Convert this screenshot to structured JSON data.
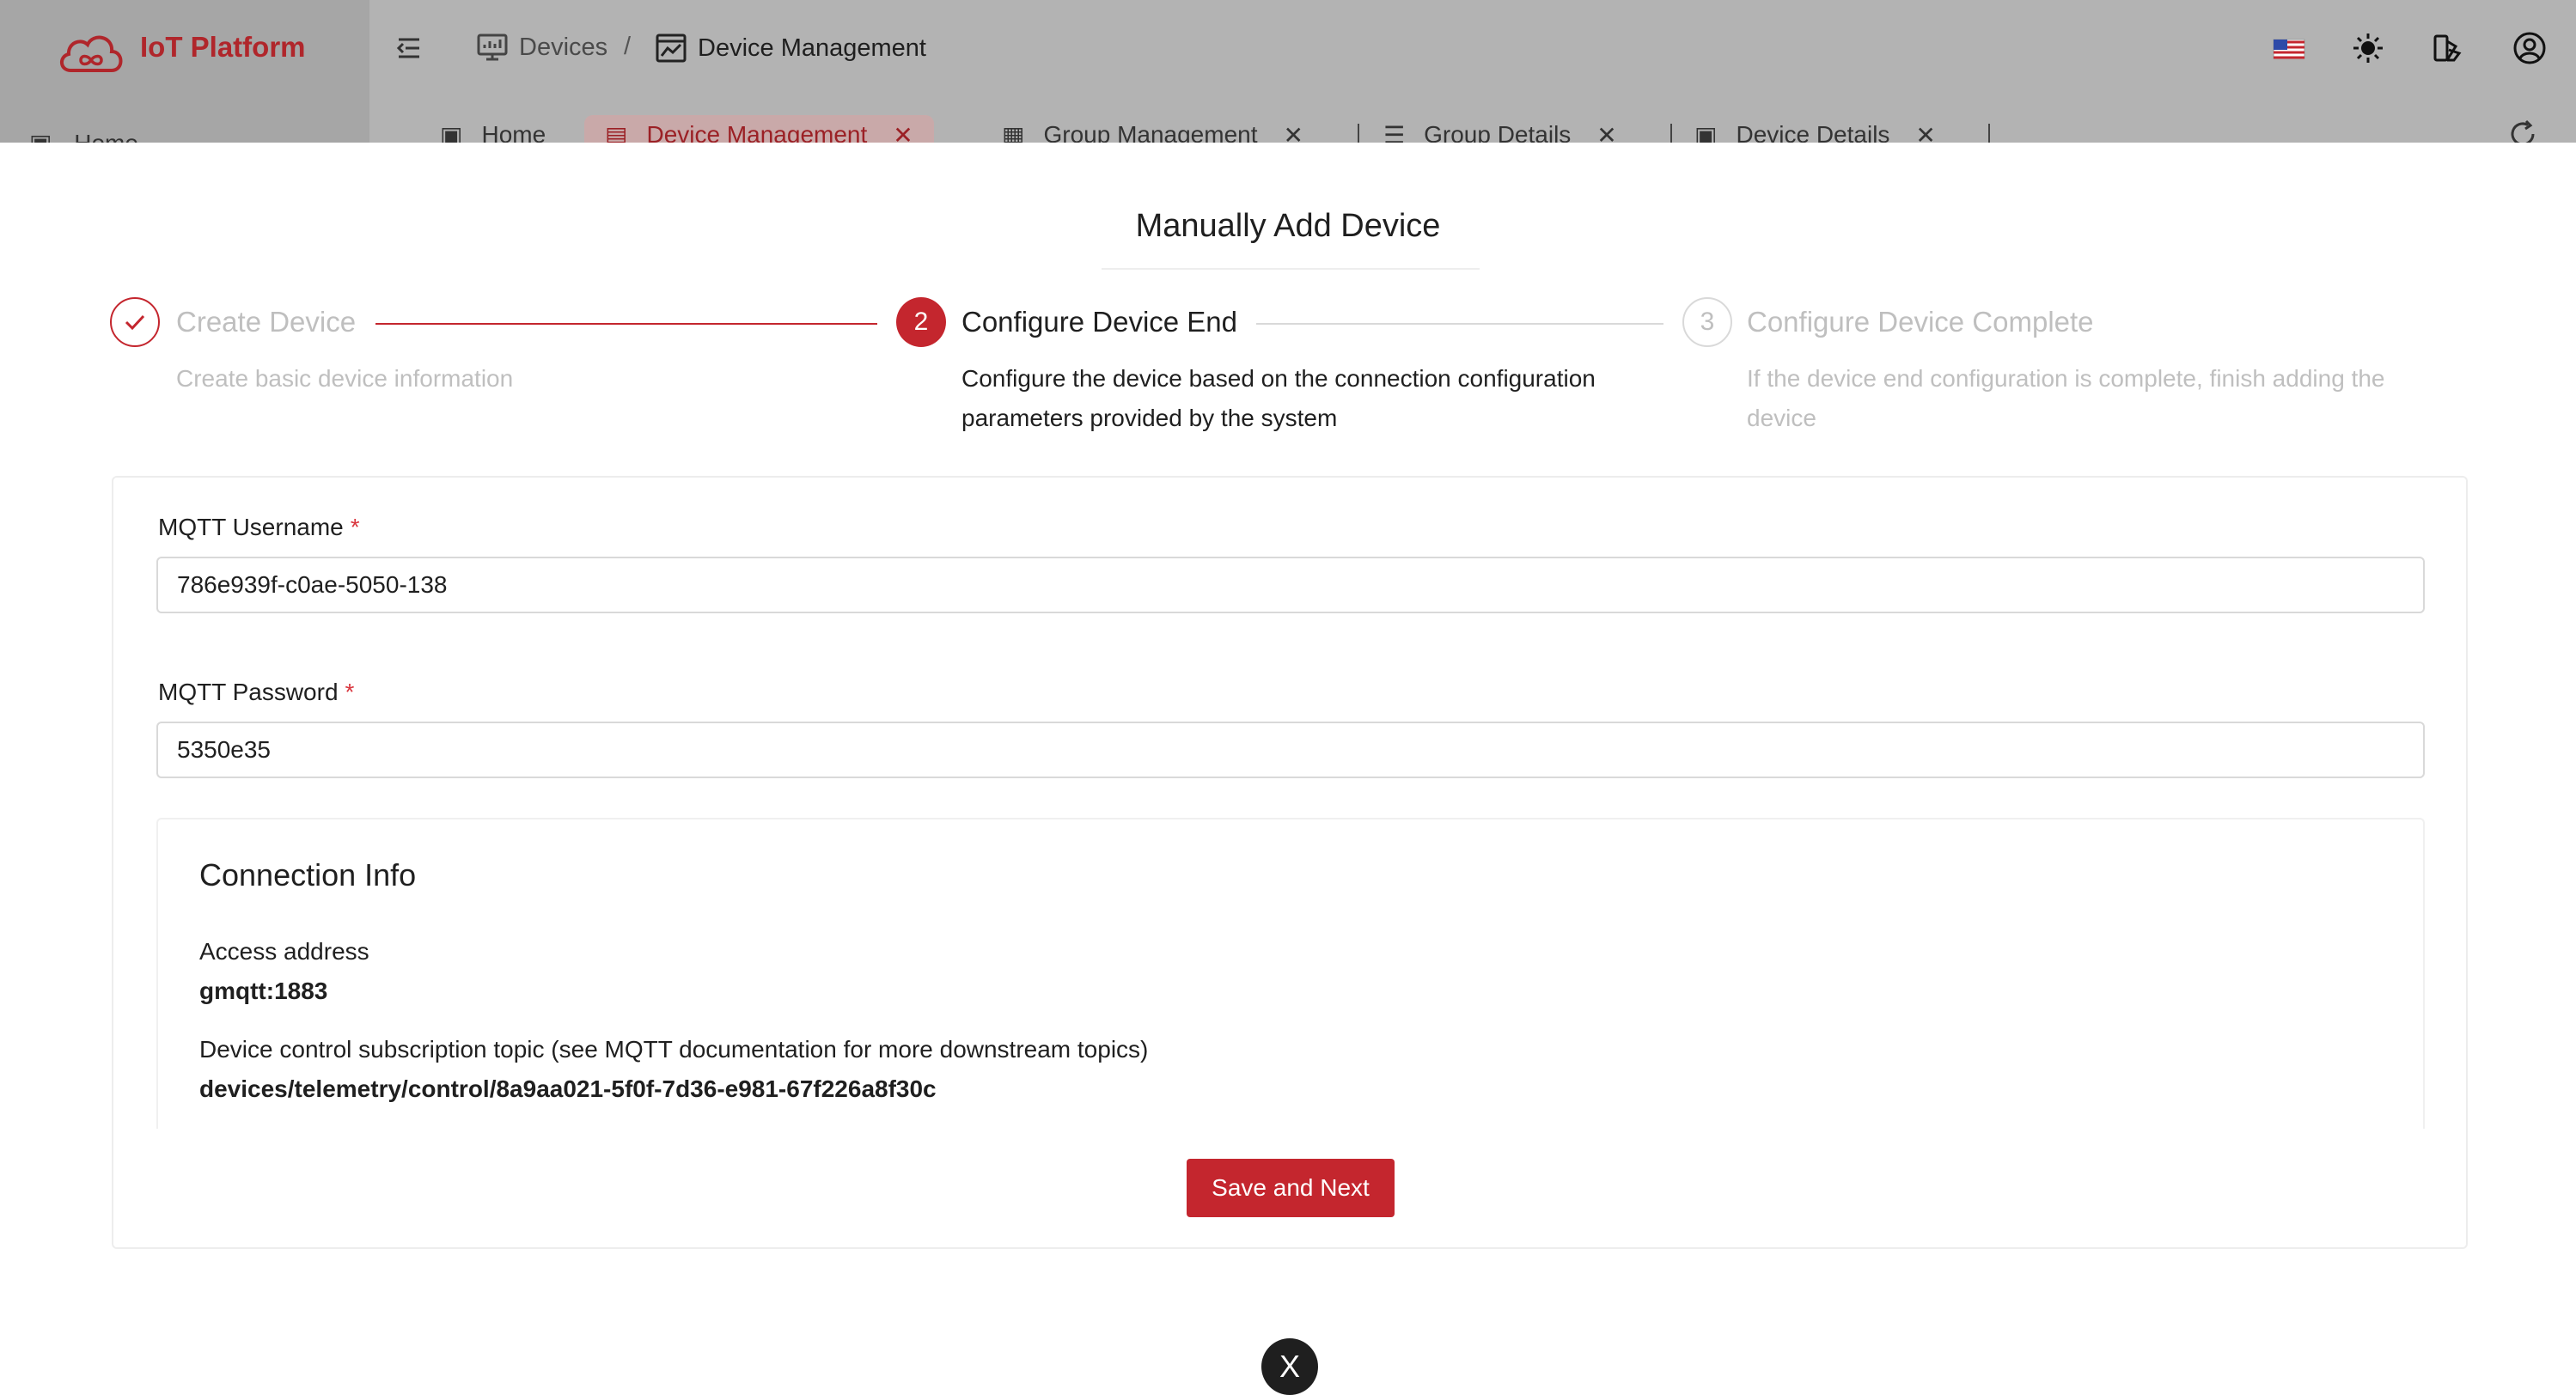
{
  "app": {
    "title": "IoT Platform"
  },
  "breadcrumb": [
    {
      "label": "Devices",
      "icon": "monitor-icon"
    },
    {
      "separator": "/"
    },
    {
      "label": "Device Management",
      "icon": "chart-window-icon"
    }
  ],
  "header_icons": [
    "us-flag-icon",
    "sun-icon",
    "theme-switch-icon",
    "user-avatar-icon"
  ],
  "tabs": [
    {
      "label": "Home",
      "icon": "home-icon",
      "closable": false
    },
    {
      "label": "Home",
      "icon": "home-icon",
      "closable": false
    },
    {
      "label": "Device Management",
      "icon": "device-icon",
      "closable": true,
      "active": true
    },
    {
      "label": "Group Management",
      "icon": "grid-icon",
      "closable": true
    },
    {
      "label": "Group Details",
      "icon": "list-icon",
      "closable": true
    },
    {
      "label": "Device Details",
      "icon": "details-icon",
      "closable": true
    }
  ],
  "modal": {
    "title": "Manually Add Device",
    "steps": [
      {
        "number": "✓",
        "title": "Create Device",
        "description": "Create basic device information",
        "status": "finished"
      },
      {
        "number": "2",
        "title": "Configure Device End",
        "description": "Configure the device based on the connection configuration parameters provided by the system",
        "status": "current"
      },
      {
        "number": "3",
        "title": "Configure Device Complete",
        "description": "If the device end configuration is complete, finish adding the device",
        "status": "waiting"
      }
    ],
    "form": {
      "username_label": "MQTT Username",
      "username_value": "786e939f-c0ae-5050-138",
      "password_label": "MQTT Password",
      "password_value": "5350e35",
      "required_mark": "*"
    },
    "connection": {
      "title": "Connection Info",
      "access_label": "Access address",
      "access_value": "gmqtt:1883",
      "topic_label": "Device control subscription topic (see MQTT documentation for more downstream topics)",
      "topic_value": "devices/telemetry/control/8a9aa021-5f0f-7d36-e981-67f226a8f30c"
    },
    "save_button": "Save and Next",
    "close_fab": "X"
  },
  "colors": {
    "brand": "#c4262e",
    "muted": "#bfbfbf",
    "overlay": "#b3b3b3"
  }
}
